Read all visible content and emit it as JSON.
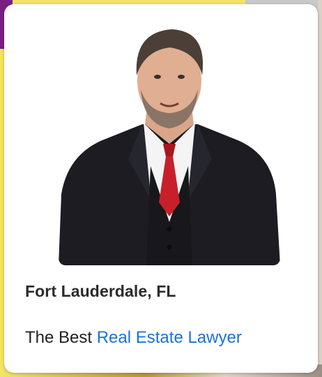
{
  "card": {
    "location": "Fort Lauderdale, FL",
    "tagline_prefix": "The Best",
    "tagline_link": "Real Estate Lawyer"
  },
  "colors": {
    "link": "#1a73d9",
    "tie": "#c8202a",
    "suit": "#1c1c22"
  },
  "photo": {
    "icon": "lawyer-portrait"
  }
}
